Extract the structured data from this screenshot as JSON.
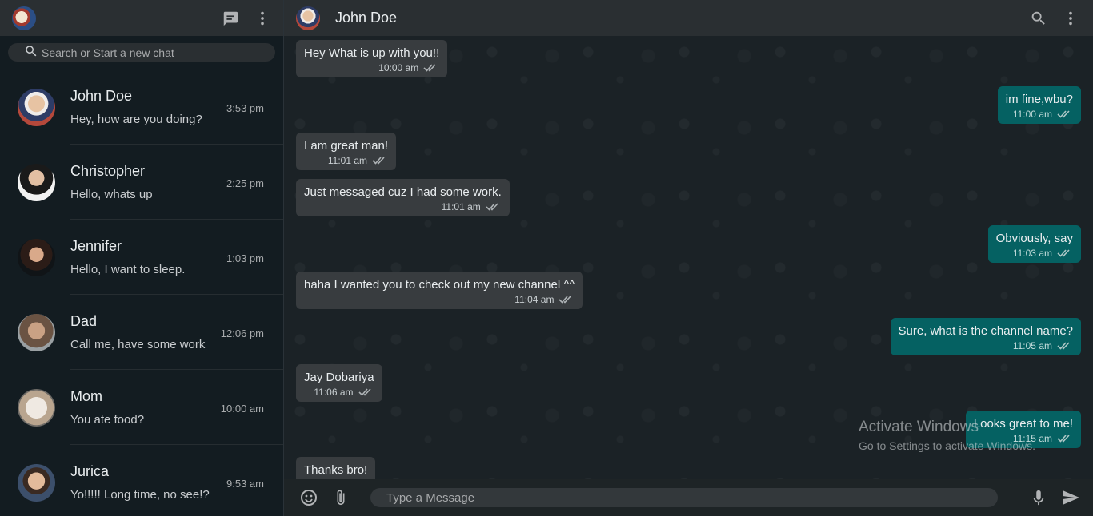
{
  "sidebar": {
    "search_placeholder": "Search or Start a new chat",
    "chats": [
      {
        "name": "John Doe",
        "preview": "Hey, how are you doing?",
        "time": "3:53 pm"
      },
      {
        "name": "Christopher",
        "preview": "Hello, whats up",
        "time": "2:25 pm"
      },
      {
        "name": "Jennifer",
        "preview": "Hello, I want to sleep.",
        "time": "1:03 pm"
      },
      {
        "name": "Dad",
        "preview": "Call me, have some work",
        "time": "12:06 pm"
      },
      {
        "name": "Mom",
        "preview": "You ate food?",
        "time": "10:00 am"
      },
      {
        "name": "Jurica",
        "preview": "Yo!!!!! Long time, no see!?",
        "time": "9:53 am"
      }
    ]
  },
  "conversation": {
    "title": "John Doe",
    "messages": [
      {
        "dir": "in",
        "text": "Hey What is up with you!!",
        "time": "10:00 am"
      },
      {
        "dir": "out",
        "text": "im fine,wbu?",
        "time": "11:00 am"
      },
      {
        "dir": "in",
        "text": "I am great man!",
        "time": "11:01 am"
      },
      {
        "dir": "in",
        "text": "Just messaged cuz I had some work.",
        "time": "11:01 am"
      },
      {
        "dir": "out",
        "text": "Obviously, say",
        "time": "11:03 am"
      },
      {
        "dir": "in",
        "text": "haha I wanted you to check out my new channel ^^",
        "time": "11:04 am"
      },
      {
        "dir": "out",
        "text": "Sure, what is the channel name?",
        "time": "11:05 am"
      },
      {
        "dir": "in",
        "text": "Jay Dobariya",
        "time": "11:06 am"
      },
      {
        "dir": "out",
        "text": "Looks great to me!",
        "time": "11:15 am"
      },
      {
        "dir": "in",
        "text": "Thanks bro!",
        "time": ""
      }
    ],
    "composer_placeholder": "Type a Message"
  },
  "watermark": {
    "title": "Activate Windows",
    "subtitle": "Go to Settings to activate Windows."
  },
  "icons": {
    "new_chat": "chat-icon",
    "menu": "more-vert-icon",
    "search": "search-icon",
    "emoji": "emoji-icon",
    "attach": "paperclip-icon",
    "mic": "mic-icon",
    "send": "send-icon",
    "read_receipt": "double-check-icon"
  },
  "colors": {
    "incoming_bubble": "#383c3f",
    "outgoing_bubble": "#056162",
    "header": "#2a2f32"
  }
}
